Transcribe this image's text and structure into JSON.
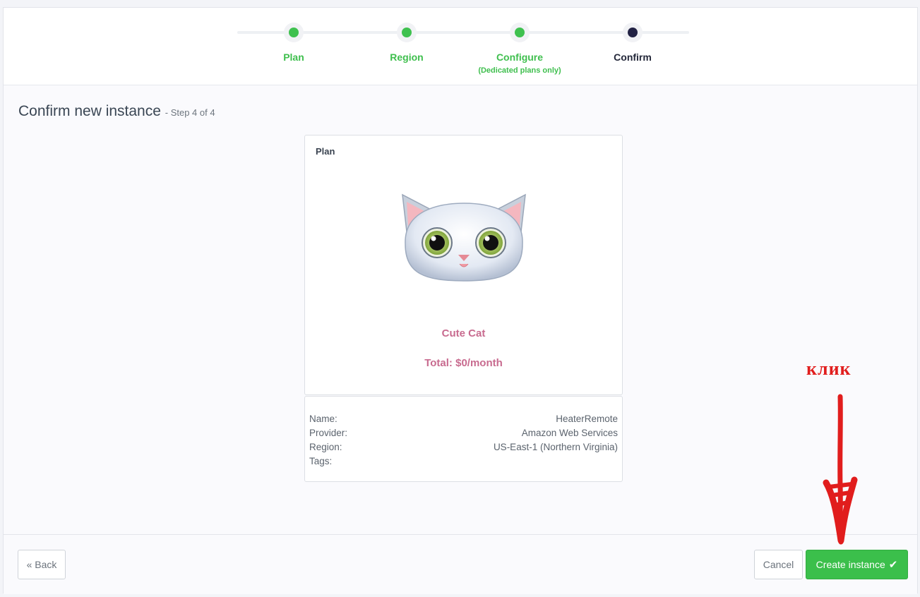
{
  "stepper": {
    "steps": [
      {
        "label": "Plan",
        "sublabel": "",
        "state": "done"
      },
      {
        "label": "Region",
        "sublabel": "",
        "state": "done"
      },
      {
        "label": "Configure",
        "sublabel": "(Dedicated plans only)",
        "state": "done"
      },
      {
        "label": "Confirm",
        "sublabel": "",
        "state": "active"
      }
    ],
    "colors": {
      "done": "#3fc14f",
      "active": "#222244"
    }
  },
  "header": {
    "title": "Confirm new instance",
    "step_text": "- Step 4 of 4"
  },
  "plan_card": {
    "heading": "Plan",
    "image_icon": "cute-cat-icon",
    "plan_name": "Cute Cat",
    "total": "Total: $0/month"
  },
  "details": {
    "rows": [
      {
        "label": "Name:",
        "value": "HeaterRemote"
      },
      {
        "label": "Provider:",
        "value": "Amazon Web Services"
      },
      {
        "label": "Region:",
        "value": "US-East-1 (Northern Virginia)"
      },
      {
        "label": "Tags:",
        "value": ""
      }
    ]
  },
  "footer": {
    "back_label": "« Back",
    "cancel_label": "Cancel",
    "create_label": "Create instance",
    "create_icon": "check-icon",
    "accent": "#3bbf4b"
  },
  "annotation": {
    "text": "клик",
    "color": "#e11d1d"
  }
}
